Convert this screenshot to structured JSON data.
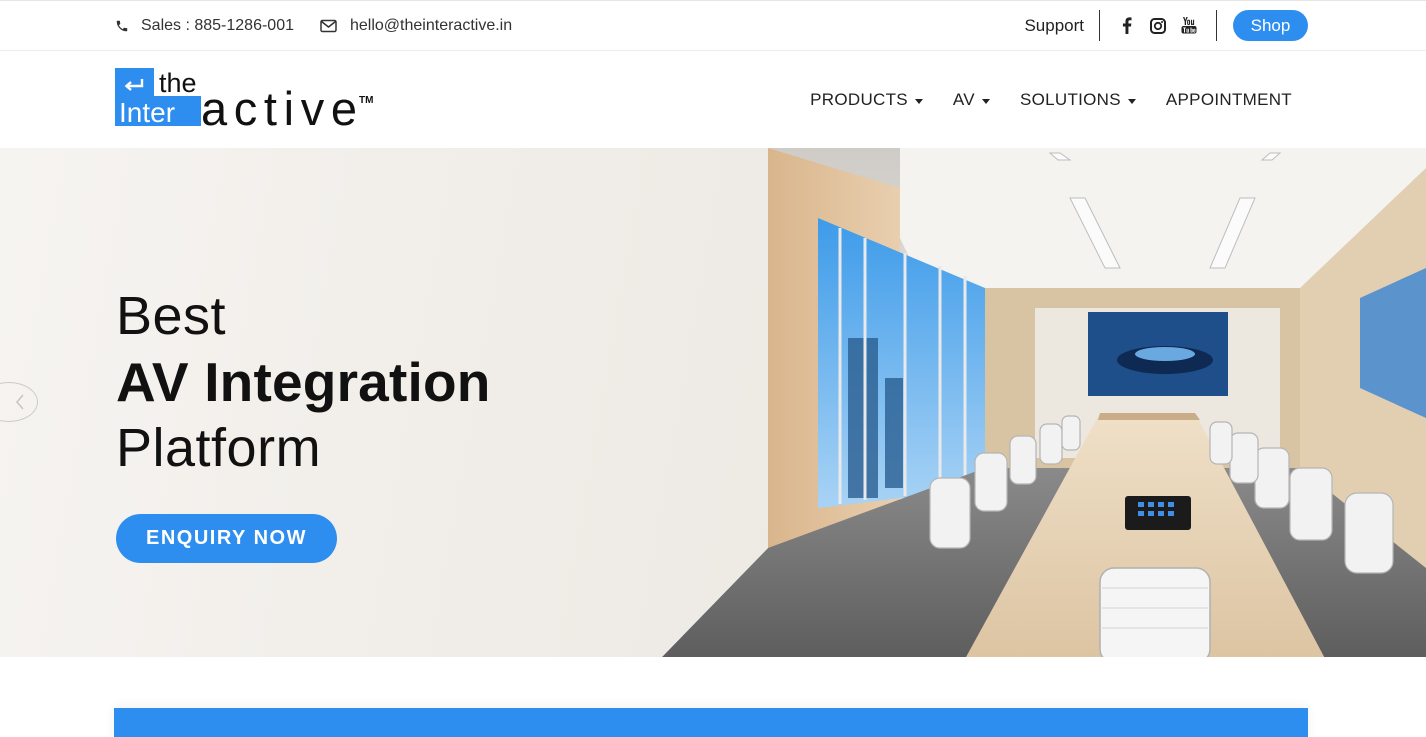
{
  "topbar": {
    "phone_text": "Sales : 885-1286-001",
    "email_text": "hello@theinteractive.in",
    "support_label": "Support",
    "socials": [
      "facebook-icon",
      "instagram-icon",
      "youtube-icon"
    ],
    "shop_label": "Shop"
  },
  "header": {
    "logo": {
      "word_the": "the",
      "word_inter": "Inter",
      "word_active": "active",
      "tm": "TM"
    },
    "nav": [
      {
        "label": "PRODUCTS",
        "dropdown": true
      },
      {
        "label": "AV",
        "dropdown": true
      },
      {
        "label": "SOLUTIONS",
        "dropdown": true
      },
      {
        "label": "APPOINTMENT",
        "dropdown": false
      }
    ]
  },
  "hero": {
    "line1": "Best",
    "line2": "AV Integration",
    "line3": "Platform",
    "cta_label": "ENQUIRY NOW"
  },
  "colors": {
    "accent": "#2e8ef0",
    "text": "#111111"
  }
}
